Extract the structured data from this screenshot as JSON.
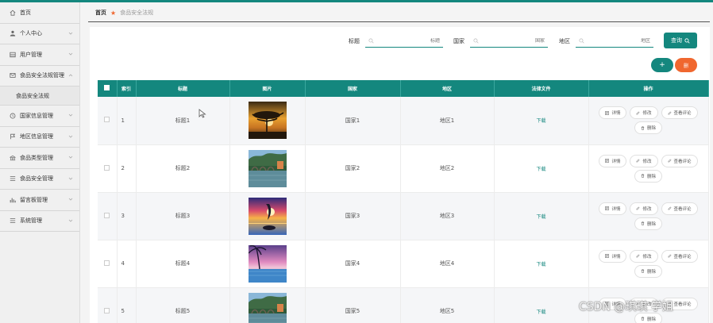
{
  "sidebar": {
    "items": [
      {
        "label": "首页",
        "icon": "home-icon"
      },
      {
        "label": "个人中心",
        "icon": "user-icon"
      },
      {
        "label": "用户管理",
        "icon": "grid-icon"
      },
      {
        "label": "食品安全法规管理",
        "icon": "mail-icon",
        "expanded": true,
        "children": [
          "食品安全法规"
        ]
      },
      {
        "label": "国家信息管理",
        "icon": "clock-icon"
      },
      {
        "label": "地区信息管理",
        "icon": "flag-icon"
      },
      {
        "label": "食品类型管理",
        "icon": "bank-icon"
      },
      {
        "label": "食品安全管理",
        "icon": "list-icon"
      },
      {
        "label": "留言板管理",
        "icon": "chart-icon"
      },
      {
        "label": "系统管理",
        "icon": "list-icon"
      }
    ]
  },
  "breadcrumb": {
    "home": "首页",
    "current": "食品安全法规"
  },
  "search": {
    "title_label": "标题",
    "title_placeholder": "标题",
    "country_label": "国家",
    "country_placeholder": "国家",
    "region_label": "地区",
    "region_placeholder": "地区",
    "button_label": "查询"
  },
  "actions": {
    "add_label": "+",
    "delete_label": "删"
  },
  "table": {
    "headers": [
      "",
      "索引",
      "标题",
      "图片",
      "国家",
      "地区",
      "法律文件",
      "操作"
    ],
    "rows": [
      {
        "index": "1",
        "title": "标题1",
        "image": "sunset-tree",
        "country": "国家1",
        "region": "地区1",
        "file": "下载"
      },
      {
        "index": "2",
        "title": "标题2",
        "image": "river-bridge",
        "country": "国家2",
        "region": "地区2",
        "file": "下载"
      },
      {
        "index": "3",
        "title": "标题3",
        "image": "sunset-sea",
        "country": "国家3",
        "region": "地区3",
        "file": "下载"
      },
      {
        "index": "4",
        "title": "标题4",
        "image": "palm-pool",
        "country": "国家4",
        "region": "地区4",
        "file": "下载"
      },
      {
        "index": "5",
        "title": "标题5",
        "image": "river-bridge",
        "country": "国家5",
        "region": "地区5",
        "file": "下载"
      }
    ],
    "ops": {
      "detail": "详情",
      "edit": "修改",
      "review": "查看评论",
      "delete": "删除"
    }
  },
  "watermark": "CSDN @琪琪 学姐",
  "colors": {
    "accent": "#14877e",
    "orange": "#f0672f"
  }
}
